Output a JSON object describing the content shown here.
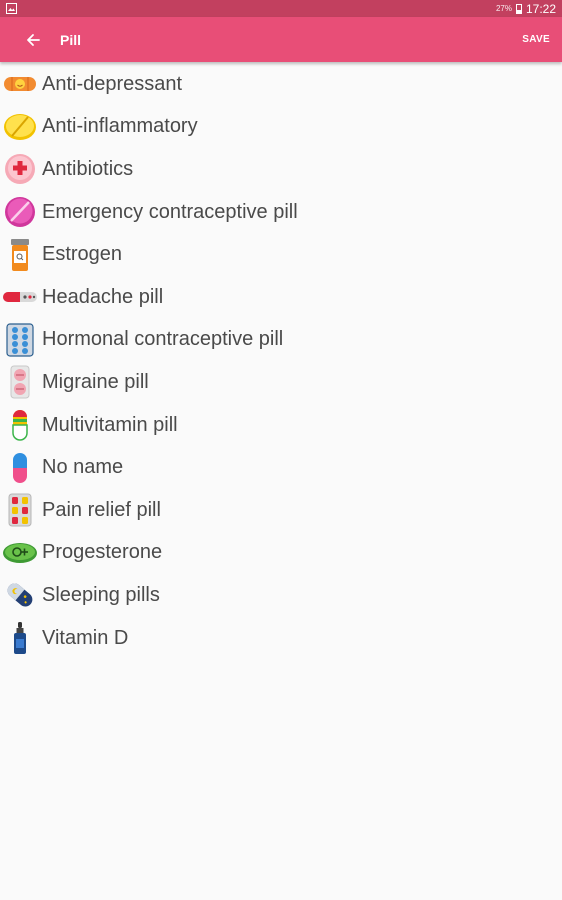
{
  "status_bar": {
    "battery": "27%",
    "time": "17:22"
  },
  "app_bar": {
    "title": "Pill",
    "save_label": "SAVE"
  },
  "colors": {
    "status_bar": "#c2405f",
    "app_bar": "#e84e77",
    "background": "#fafafa"
  },
  "pills": [
    {
      "label": "Anti-depressant",
      "icon": "orange-capsule-smile-icon"
    },
    {
      "label": "Anti-inflammatory",
      "icon": "yellow-round-pill-icon"
    },
    {
      "label": "Antibiotics",
      "icon": "pink-cross-pill-icon"
    },
    {
      "label": "Emergency contraceptive pill",
      "icon": "magenta-round-pill-icon"
    },
    {
      "label": "Estrogen",
      "icon": "pill-bottle-icon"
    },
    {
      "label": "Headache pill",
      "icon": "red-capsule-icon"
    },
    {
      "label": "Hormonal contraceptive pill",
      "icon": "blister-pack-icon"
    },
    {
      "label": "Migraine pill",
      "icon": "pink-pill-strip-icon"
    },
    {
      "label": "Multivitamin pill",
      "icon": "rainbow-capsule-icon"
    },
    {
      "label": "No name",
      "icon": "pink-blue-capsule-icon"
    },
    {
      "label": "Pain relief pill",
      "icon": "red-yellow-blister-icon"
    },
    {
      "label": "Progesterone",
      "icon": "green-female-pill-icon"
    },
    {
      "label": "Sleeping pills",
      "icon": "moon-star-capsule-icon"
    },
    {
      "label": "Vitamin D",
      "icon": "dropper-bottle-icon"
    }
  ]
}
